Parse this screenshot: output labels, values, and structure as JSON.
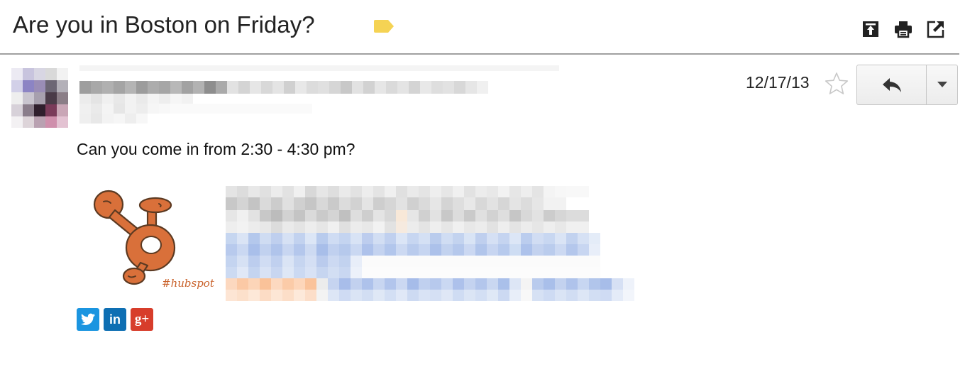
{
  "email": {
    "subject": "Are you in Boston on Friday?",
    "date": "12/17/13",
    "body": "Can you come in from 2:30 - 4:30 pm?"
  },
  "signature": {
    "logo_text": "#hubspot"
  },
  "icons": {
    "label": "label-tag-icon",
    "archive": "move-to-top-icon",
    "print": "print-icon",
    "popout": "open-new-window-icon",
    "star": "star-outline-icon",
    "reply": "reply-arrow-icon",
    "more": "chevron-down-icon",
    "social": [
      "twitter-icon",
      "linkedin-icon",
      "google-plus-icon"
    ]
  },
  "social_labels": {
    "linkedin": "in",
    "google_plus": "g+"
  },
  "colors": {
    "label_tag": "#f5d354",
    "twitter": "#1b95e0",
    "linkedin": "#0e6fb3",
    "google_plus": "#d73d2b",
    "hubspot_orange": "#d9703a"
  }
}
